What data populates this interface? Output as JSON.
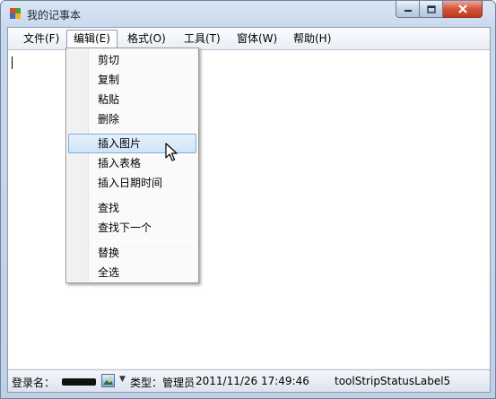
{
  "window": {
    "title": "我的记事本"
  },
  "menubar": {
    "items": [
      {
        "label": "文件(F)"
      },
      {
        "label": "编辑(E)"
      },
      {
        "label": "格式(O)"
      },
      {
        "label": "工具(T)"
      },
      {
        "label": "窗体(W)"
      },
      {
        "label": "帮助(H)"
      }
    ]
  },
  "edit_menu": {
    "items": [
      {
        "label": "剪切"
      },
      {
        "label": "复制"
      },
      {
        "label": "粘贴"
      },
      {
        "label": "删除"
      },
      {
        "label": "插入图片"
      },
      {
        "label": "插入表格"
      },
      {
        "label": "插入日期时间"
      },
      {
        "label": "查找"
      },
      {
        "label": "查找下一个"
      },
      {
        "label": "替换"
      },
      {
        "label": "全选"
      }
    ],
    "highlighted": "插入图片"
  },
  "editor": {
    "content": ""
  },
  "statusbar": {
    "login_label": "登录名：",
    "type_text": "类型：管理员",
    "datetime": "2011/11/26 17:49:46",
    "label5": "toolStripStatusLabel5"
  },
  "colors": {
    "highlight": "#cfe4f8",
    "close_button": "#c0381c",
    "title_bar": "#c9d9ec"
  },
  "icons": {
    "app": "notepad-app-icon",
    "minimize": "minimize-icon",
    "maximize": "maximize-icon",
    "close": "close-icon",
    "status_picture": "picture-icon",
    "cursor": "mouse-pointer-icon"
  }
}
